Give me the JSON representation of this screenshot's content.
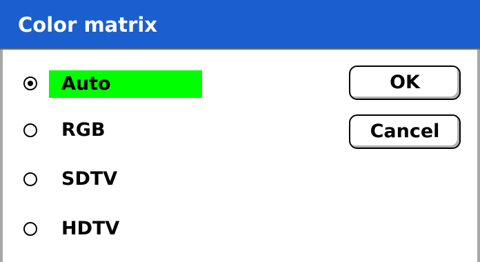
{
  "window": {
    "title": "Color matrix"
  },
  "options": [
    {
      "label": "Auto",
      "selected": true
    },
    {
      "label": "RGB",
      "selected": false
    },
    {
      "label": "SDTV",
      "selected": false
    },
    {
      "label": "HDTV",
      "selected": false
    }
  ],
  "buttons": {
    "ok_label": "OK",
    "cancel_label": "Cancel"
  },
  "colors": {
    "title_bar": "#1b5fcf",
    "title_text": "#ffffff",
    "highlight": "#00ff00",
    "border": "#a8a8a8"
  }
}
